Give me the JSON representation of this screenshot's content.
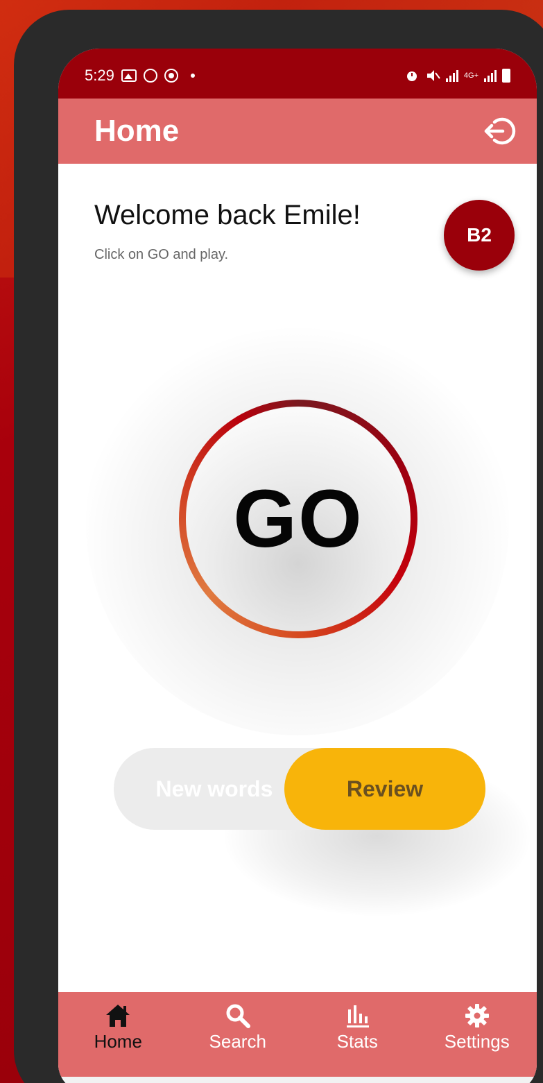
{
  "status_bar": {
    "time": "5:29",
    "network": "4G+"
  },
  "app_bar": {
    "title": "Home",
    "logout_icon": "logout-icon"
  },
  "welcome": {
    "heading": "Welcome back Emile!",
    "subtitle": "Click on GO and play."
  },
  "level_badge": "B2",
  "go_button": {
    "label": "GO"
  },
  "mode_toggle": {
    "options": [
      "New words",
      "Review"
    ],
    "selected": "Review"
  },
  "bottom_nav": {
    "items": [
      {
        "label": "Home",
        "icon": "home-icon"
      },
      {
        "label": "Search",
        "icon": "search-icon"
      },
      {
        "label": "Stats",
        "icon": "stats-icon"
      },
      {
        "label": "Settings",
        "icon": "gear-icon"
      }
    ],
    "active": "Home"
  },
  "colors": {
    "status_bar": "#9a000a",
    "app_bar": "#e06a6a",
    "badge": "#9a000a",
    "review_active": "#f8b40a"
  }
}
